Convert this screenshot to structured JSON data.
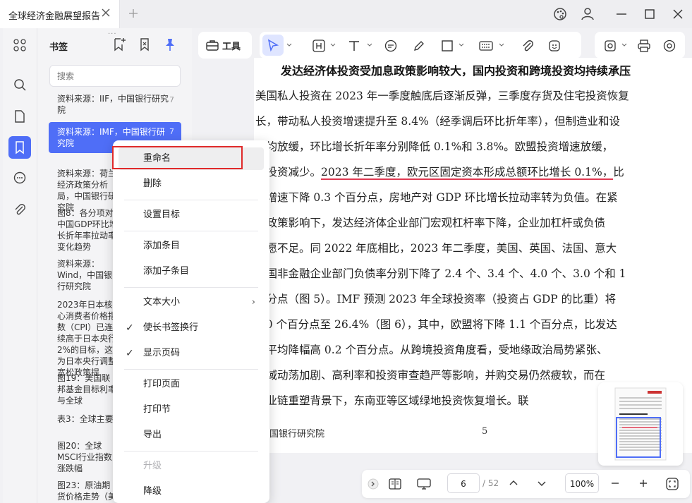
{
  "tab": {
    "title": "全球经济金融展望报告"
  },
  "sidebar": {
    "panel_title": "书签",
    "search_placeholder": "搜索",
    "bookmarks": [
      {
        "text": "资料来源：IIF，中国银行研究院",
        "page": "7"
      },
      {
        "text": "资料来源：IMF，中国银行研究院",
        "page": "7"
      },
      {
        "text": "资料来源：荷兰经济政策分析局，中国银行研究院",
        "page": ""
      },
      {
        "text": "图8：各分项对中国GDP环比增长折年率拉动率变化趋势",
        "page": ""
      },
      {
        "text": "资料来源：Wind，中国银行研究院",
        "page": ""
      },
      {
        "text": "2023年日本核心消费者价格指数（CPI）已连续高于日本央行2%的目标，这为日本央行调整宽松政策提",
        "page": ""
      },
      {
        "text": "图19：美国联邦基金目标利率与全球",
        "page": ""
      },
      {
        "text": "表3：全球主要",
        "page": ""
      },
      {
        "text": "图20：全球MSCI行业指数涨跌幅",
        "page": ""
      },
      {
        "text": "图23：原油期货价格走势（美元",
        "page": ""
      }
    ]
  },
  "toolbar": {
    "tool_label": "工具"
  },
  "context_menu": {
    "items": [
      {
        "label": "重命名",
        "checked": false,
        "submenu": false,
        "disabled": false
      },
      {
        "label": "删除",
        "checked": false,
        "submenu": false,
        "disabled": false
      },
      {
        "label": "设置目标",
        "checked": false,
        "submenu": false,
        "disabled": false
      },
      {
        "label": "添加条目",
        "checked": false,
        "submenu": false,
        "disabled": false
      },
      {
        "label": "添加子条目",
        "checked": false,
        "submenu": false,
        "disabled": false
      },
      {
        "label": "文本大小",
        "checked": false,
        "submenu": true,
        "disabled": false
      },
      {
        "label": "使长书签换行",
        "checked": true,
        "submenu": false,
        "disabled": false
      },
      {
        "label": "显示页码",
        "checked": true,
        "submenu": false,
        "disabled": false
      },
      {
        "label": "打印页面",
        "checked": false,
        "submenu": false,
        "disabled": false
      },
      {
        "label": "打印节",
        "checked": false,
        "submenu": false,
        "disabled": false
      },
      {
        "label": "导出",
        "checked": false,
        "submenu": false,
        "disabled": false
      },
      {
        "label": "升级",
        "checked": false,
        "submenu": false,
        "disabled": true
      },
      {
        "label": "降级",
        "checked": false,
        "submenu": false,
        "disabled": false
      }
    ]
  },
  "document": {
    "heading": "发达经济体投资受加息政策影响较大，国内投资和跨境投资均持续承压",
    "lines": [
      "美国私人投资在 2023 年一季度触底后逐渐反弹，三季度存货及住宅投资恢复",
      "长，带动私人投资增速提升至 8.4%（经季调后环比折年率），但制造业和设",
      "资均放缓，环比增长折年率分别降低 0.1%和 3.8%。欧盟投资增速放缓，",
      "产投资减少。",
      "度增速下降 0.3 个百分点，房地产对 GDP 环比增长拉动率转为负值。在紧",
      "币政策影响下，发达经济体企业部门宏观杠杆率下降，企业加杠杆或负债",
      "意愿不足。同 2022 年底相比，2023 年二季度，美国、英国、法国、意大",
      "德国非金融企业部门负债率分别下降了 2.4 个、3.4 个、4.0 个、3.0 个和 1",
      "百分点（图 5）。IMF 预测 2023 年全球投资率（投资占 GDP 的比重）将",
      "1.0 个百分点至 26.4%（图 6），其中，欧盟将下降 1.1 个百分点，比发达",
      "体平均降幅高 0.2 个百分点。从跨境投资角度看，受地缘政治局势紧张、",
      "领域动荡加剧、高利率和投资审查趋严等影响，并购交易仍然疲软，而在",
      "产业链重塑背景下，东南亚等区域绿地投资恢复增长。联"
    ],
    "underlined_text": "2023 年二季度，欧元区固定资本形成总额环比增长 0.1%，",
    "underlined_tail": "比",
    "footer_left": "国银行研究院",
    "footer_page": "5"
  },
  "bottombar": {
    "page_current": "6",
    "page_total": "/ 52",
    "zoom": "100%"
  }
}
